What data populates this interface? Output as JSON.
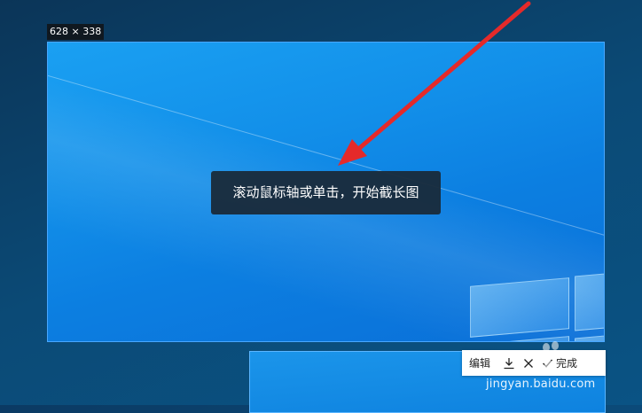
{
  "selection": {
    "size_label": "628 × 338"
  },
  "tooltip": {
    "text": "滚动鼠标轴或单击，开始截长图"
  },
  "toolbar": {
    "edit_label": "编辑",
    "save_icon": "download-icon",
    "close_icon": "close-icon",
    "done_label": "完成",
    "done_icon": "check-icon"
  },
  "watermark": {
    "text": "jingyan.baidu.com"
  },
  "colors": {
    "accent": "#1a8fe9",
    "arrow": "#e52a2a"
  }
}
